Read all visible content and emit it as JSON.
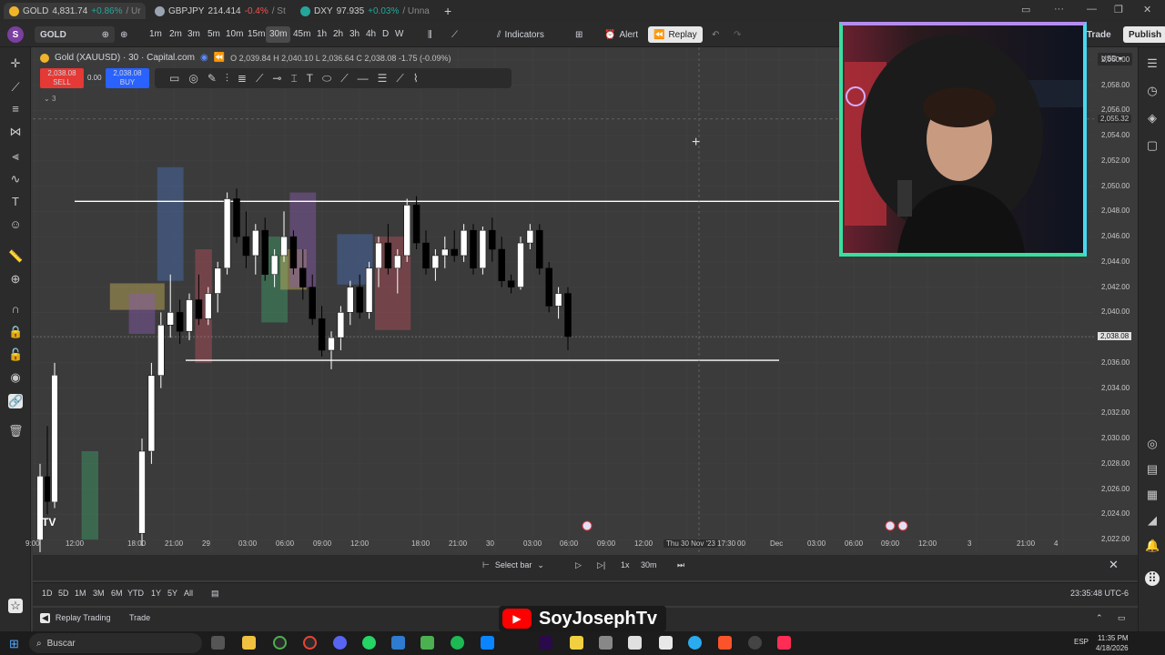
{
  "browser_tabs": [
    {
      "symbol": "GOLD",
      "price": "4,831.74",
      "change": "+0.86%",
      "suffix": "/ Ur",
      "dir": "up",
      "color": "#f0b429"
    },
    {
      "symbol": "GBPJPY",
      "price": "214.414",
      "change": "-0.4%",
      "suffix": "/ St",
      "dir": "dn",
      "color": "#9aa4b0"
    },
    {
      "symbol": "DXY",
      "price": "97.935",
      "change": "+0.03%",
      "suffix": "/ Unna",
      "dir": "up",
      "color": "#26a69a"
    }
  ],
  "toolbar": {
    "symbol_search": "GOLD",
    "timeframes": [
      "1m",
      "2m",
      "3m",
      "5m",
      "10m",
      "15m",
      "30m",
      "45m",
      "1h",
      "2h",
      "3h",
      "4h",
      "D",
      "W"
    ],
    "selected_timeframe": "30m",
    "indicators_label": "Indicators",
    "alert_label": "Alert",
    "replay_label": "Replay",
    "trade_label": "Trade",
    "publish_label": "Publish"
  },
  "legend": {
    "title": "Gold (XAUUSD) · 30 · Capital.com",
    "ohlc": "O 2,039.84  H 2,040.10  L 2,036.64  C 2,038.08  -1.75 (-0.09%)",
    "sell_price": "2,038.08",
    "sell_label": "SELL",
    "spread": "0.00",
    "buy_price": "2,038.08",
    "buy_label": "BUY",
    "collapsed_count": "3"
  },
  "price_axis": {
    "currency": "USD",
    "ticks": [
      "2,060.00",
      "2,058.00",
      "2,056.00",
      "2,054.00",
      "2,052.00",
      "2,050.00",
      "2,048.00",
      "2,046.00",
      "2,044.00",
      "2,042.00",
      "2,040.00",
      "2,038.00",
      "2,036.00",
      "2,034.00",
      "2,032.00",
      "2,030.00",
      "2,028.00",
      "2,026.00",
      "2,024.00",
      "2,022.00"
    ],
    "crosshair_price": "2,055.32",
    "last_price": "2,038.08"
  },
  "time_axis": {
    "labels": [
      "9:00",
      "12:00",
      "18:00",
      "21:00",
      "29",
      "03:00",
      "06:00",
      "09:00",
      "12:00",
      "18:00",
      "21:00",
      "30",
      "03:00",
      "06:00",
      "09:00",
      "12:00",
      "Thu 30 Nov '23",
      "17:30",
      "00",
      "Dec",
      "03:00",
      "06:00",
      "09:00",
      "12:00",
      "3",
      "21:00",
      "4"
    ]
  },
  "replay_bar": {
    "select_bar": "Select bar",
    "speed": "1x",
    "interval": "30m"
  },
  "range_bar": {
    "ranges": [
      "1D",
      "5D",
      "1M",
      "3M",
      "6M",
      "YTD",
      "1Y",
      "5Y",
      "All"
    ],
    "clock": "23:35:48 UTC-6"
  },
  "trade_bar": {
    "replay_trading": "Replay Trading",
    "trade": "Trade"
  },
  "watermark": {
    "channel": "SoyJosephTv"
  },
  "taskbar": {
    "search_placeholder": "Buscar",
    "language": "ESP",
    "time": "11:35 PM",
    "date": "4/18/2026"
  },
  "colors": {
    "bull": "#ffffff",
    "bear": "#000000",
    "sell": "#e53935",
    "buy": "#2962ff",
    "zone_blue": "#4a6fb5",
    "zone_red": "#b5505a",
    "zone_purple": "#8a5bb0",
    "zone_green": "#3fa06a",
    "zone_yellow": "#c9b35a"
  },
  "chart_data": {
    "type": "candlestick",
    "symbol": "Gold (XAUUSD)",
    "interval": "30",
    "ylim": [
      2021,
      2061
    ],
    "candles": [
      [
        2022.5,
        2030,
        2021.5,
        2029
      ],
      [
        2029,
        2036,
        2028,
        2035
      ],
      [
        2035,
        2040,
        2034,
        2039
      ],
      [
        2039,
        2043,
        2038,
        2040
      ],
      [
        2040,
        2041,
        2037.5,
        2038.5
      ],
      [
        2038.5,
        2041.5,
        2037.8,
        2041
      ],
      [
        2041,
        2043,
        2039,
        2039.5
      ],
      [
        2039.5,
        2042,
        2039,
        2041.5
      ],
      [
        2041.5,
        2044,
        2040,
        2043.5
      ],
      [
        2043.5,
        2049.5,
        2043,
        2049
      ],
      [
        2049,
        2049.8,
        2045.5,
        2046
      ],
      [
        2046,
        2048,
        2043.5,
        2044.5
      ],
      [
        2044.5,
        2047,
        2043,
        2046.5
      ],
      [
        2046.5,
        2047.5,
        2042.5,
        2043
      ],
      [
        2043,
        2045,
        2042,
        2044.5
      ],
      [
        2044.5,
        2048,
        2044,
        2046
      ],
      [
        2046,
        2046.5,
        2043,
        2043.5
      ],
      [
        2043.5,
        2045,
        2041,
        2042
      ],
      [
        2042,
        2043,
        2039,
        2039.5
      ],
      [
        2039.5,
        2040.5,
        2036.5,
        2037
      ],
      [
        2037,
        2038.5,
        2035.5,
        2038
      ],
      [
        2038,
        2040.5,
        2037,
        2040
      ],
      [
        2040,
        2042.5,
        2039,
        2042
      ],
      [
        2042,
        2043,
        2039.5,
        2040
      ],
      [
        2040,
        2044,
        2039.5,
        2043.5
      ],
      [
        2043.5,
        2046,
        2042,
        2045.5
      ],
      [
        2045.5,
        2047,
        2043,
        2043.5
      ],
      [
        2043.5,
        2045,
        2041.5,
        2044.5
      ],
      [
        2044.5,
        2049,
        2044,
        2048.5
      ],
      [
        2048.5,
        2049.2,
        2045,
        2045.5
      ],
      [
        2045.5,
        2046.5,
        2043,
        2043.5
      ],
      [
        2043.5,
        2045,
        2042.5,
        2044.5
      ],
      [
        2044.5,
        2046,
        2043.5,
        2045
      ],
      [
        2045,
        2046.5,
        2044,
        2044.5
      ],
      [
        2044.5,
        2047,
        2044,
        2046.5
      ],
      [
        2046.5,
        2047,
        2043,
        2043.5
      ],
      [
        2043.5,
        2046.8,
        2043,
        2046.5
      ],
      [
        2046.5,
        2047.5,
        2044,
        2045
      ],
      [
        2045,
        2046,
        2042,
        2042.5
      ],
      [
        2042.5,
        2043,
        2041.5,
        2042
      ],
      [
        2042,
        2046,
        2041.8,
        2045.5
      ],
      [
        2045.5,
        2047,
        2045,
        2046.5
      ],
      [
        2046.5,
        2047,
        2043,
        2043.5
      ],
      [
        2043.5,
        2044,
        2040,
        2040.5
      ],
      [
        2040.5,
        2042,
        2039.5,
        2041.5
      ],
      [
        2041.5,
        2042,
        2037,
        2038.08
      ]
    ],
    "horizontal_levels": [
      2048.8,
      2036.2
    ],
    "zones": [
      {
        "color": "zone_blue",
        "from": 2,
        "to": 4,
        "top": 2051.5,
        "bottom": 2042.5
      },
      {
        "color": "zone_yellow",
        "from": -3,
        "to": 2,
        "top": 2042.3,
        "bottom": 2040.2
      },
      {
        "color": "zone_purple",
        "from": -1,
        "to": 1,
        "top": 2041.5,
        "bottom": 2038.3
      },
      {
        "color": "zone_red",
        "from": 6,
        "to": 7,
        "top": 2045,
        "bottom": 2036
      },
      {
        "color": "zone_green",
        "from": 13,
        "to": 15,
        "top": 2046,
        "bottom": 2039.2
      },
      {
        "color": "zone_yellow",
        "from": 15,
        "to": 17,
        "top": 2045,
        "bottom": 2041.8
      },
      {
        "color": "zone_purple",
        "from": 16,
        "to": 18,
        "top": 2049.5,
        "bottom": 2042
      },
      {
        "color": "zone_blue",
        "from": 21,
        "to": 24,
        "top": 2046.2,
        "bottom": 2042.2
      },
      {
        "color": "zone_red",
        "from": 25,
        "to": 28,
        "top": 2046,
        "bottom": 2038.6
      },
      {
        "color": "zone_green",
        "from": -6,
        "to": -5,
        "top": 2029,
        "bottom": 2022
      }
    ]
  }
}
